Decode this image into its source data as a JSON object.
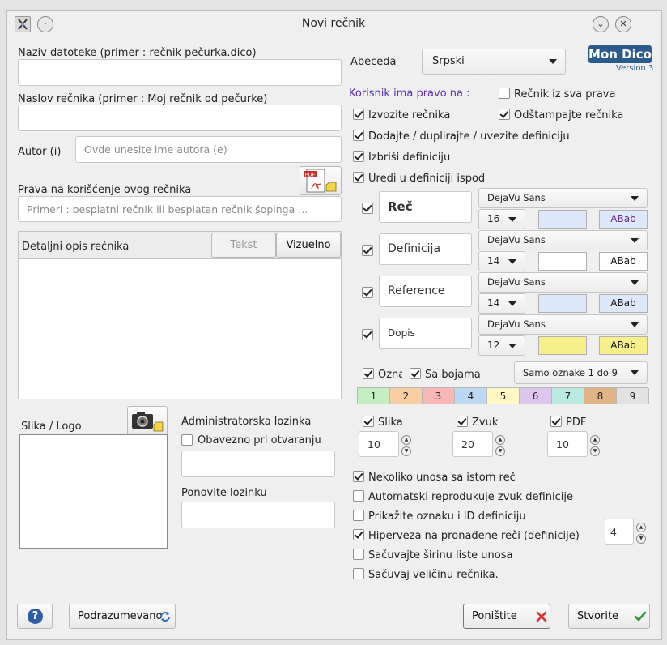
{
  "window": {
    "title": "Novi rečnik",
    "app_icon": "mondico-app-icon",
    "pin_label": "·",
    "minimize_label": "⌄",
    "close_label": "✕"
  },
  "left": {
    "filename_label": "Naziv datoteke (primer : rečnik pečurka.dico)",
    "filename_value": "",
    "title_label": "Naslov rečnika (primer : Moj rečnik od pečurke)",
    "title_value": "",
    "author_label": "Autor (i)",
    "author_placeholder": "Ovde unesite ime autora (e)",
    "rights_label": "Prava na korišćenje ovog rečnika",
    "rights_placeholder": "Primeri : besplatni rečnik ili besplatan rečnik šopinga ...",
    "pdf_icon_text": "PDF",
    "description_label": "Detaljni opis rečnika",
    "tab_text": "Tekst",
    "tab_visual": "Vizuelno",
    "logo_label": "Slika / Logo",
    "admin_password_label": "Administratorska lozinka",
    "mandatory_on_open_label": "Obavezno pri otvaranju",
    "repeat_password_label": "Ponovite lozinku"
  },
  "right": {
    "alphabet_label": "Abeceda",
    "alphabet_value": "Srpski",
    "logo_title": "Mon Dico",
    "logo_version": "Version 3",
    "rights_header": "Korisnik ima pravo na :",
    "all_rights_label": "Rečnik iz sva prava",
    "export_label": "Izvozite rečnika",
    "print_label": "Odštampajte rečnika",
    "add_label": "Dodajte / duplirajte / uvezite definiciju",
    "delete_label": "Izbriši definiciju",
    "edit_label": "Uredi u definiciji ispod",
    "styles": [
      {
        "name": "Reč",
        "font": "DejaVu Sans",
        "size": "16",
        "bg": "#dde8fb",
        "sample": "ABab",
        "sample_color": "#6a2c8e",
        "sample_bg": "#dde8fb",
        "bold": true
      },
      {
        "name": "Definicija",
        "font": "DejaVu Sans",
        "size": "14",
        "bg": "#ffffff",
        "sample": "ABab",
        "sample_color": "#111111",
        "sample_bg": "#ffffff",
        "bold": false
      },
      {
        "name": "Reference",
        "font": "DejaVu Sans",
        "size": "14",
        "bg": "#dde8fb",
        "sample": "ABab",
        "sample_color": "#111111",
        "sample_bg": "#dde8fb",
        "bold": false
      },
      {
        "name": "Dopis",
        "font": "DejaVu Sans",
        "size": "12",
        "bg": "#f7f08a",
        "sample": "ABab",
        "sample_color": "#111111",
        "sample_bg": "#f7f08a",
        "bold": false
      }
    ],
    "tags_label": "Oznal",
    "colors_label": "Sa bojama",
    "tags_range_value": "Samo oznake 1 do 9",
    "tag_cells": [
      {
        "label": "1",
        "color": "#c5efc0"
      },
      {
        "label": "2",
        "color": "#f8cfa3"
      },
      {
        "label": "3",
        "color": "#f7b7b7"
      },
      {
        "label": "4",
        "color": "#bcd8f3"
      },
      {
        "label": "5",
        "color": "#fff8c2"
      },
      {
        "label": "6",
        "color": "#dcc6ee"
      },
      {
        "label": "7",
        "color": "#b9ebe1"
      },
      {
        "label": "8",
        "color": "#e1b488"
      },
      {
        "label": "9",
        "color": "#e2e2e2"
      }
    ],
    "image_label": "Slika",
    "image_value": "10",
    "sound_label": "Zvuk",
    "sound_value": "20",
    "pdf_label": "PDF",
    "pdf_value": "10",
    "options": [
      {
        "label": "Nekoliko unosa sa istom reč",
        "checked": true
      },
      {
        "label": "Automatski reprodukuje zvuk definicije",
        "checked": false
      },
      {
        "label": "Prikažite oznaku i ID definiciju",
        "checked": false
      },
      {
        "label": "Hiperveza na pronađene reči (definicije)",
        "checked": true
      },
      {
        "label": "Sačuvajte širinu liste unosa",
        "checked": false
      },
      {
        "label": "Sačuvaj veličinu rečnika.",
        "checked": false
      }
    ],
    "hyperlink_count": "4"
  },
  "footer": {
    "help_label": "?",
    "default_label": "Podrazumevano",
    "cancel_label": "Poništite",
    "create_label": "Stvorite"
  },
  "colors": {
    "accent_purple": "#5b2fb0",
    "logo_blue": "#2b5a8c",
    "ok_green": "#2f9a35",
    "cancel_red": "#d8323a"
  }
}
